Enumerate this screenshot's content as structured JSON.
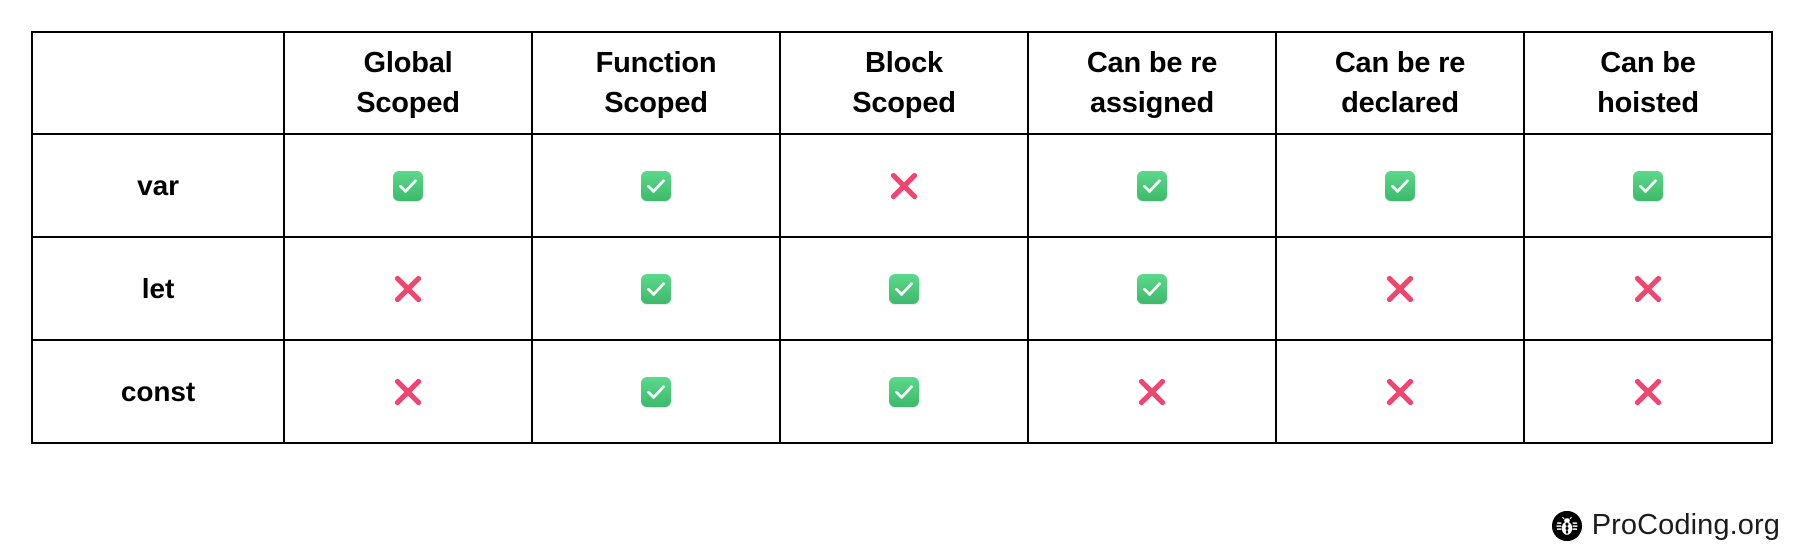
{
  "table": {
    "corner_label": "",
    "columns": [
      {
        "label": "Global\nScoped",
        "name": "global-scoped"
      },
      {
        "label": "Function\nScoped",
        "name": "function-scoped"
      },
      {
        "label": "Block\nScoped",
        "name": "block-scoped"
      },
      {
        "label": "Can be re\nassigned",
        "name": "can-be-reassigned"
      },
      {
        "label": "Can be re\ndeclared",
        "name": "can-be-redeclared"
      },
      {
        "label": "Can be\nhoisted",
        "name": "can-be-hoisted"
      }
    ],
    "rows": [
      {
        "label": "var",
        "values": [
          "yes",
          "yes",
          "no",
          "yes",
          "yes",
          "yes"
        ]
      },
      {
        "label": "let",
        "values": [
          "no",
          "yes",
          "yes",
          "yes",
          "no",
          "no"
        ]
      },
      {
        "label": "const",
        "values": [
          "no",
          "yes",
          "yes",
          "no",
          "no",
          "no"
        ]
      }
    ]
  },
  "marks": {
    "yes_icon": "check-mark-icon",
    "no_icon": "cross-mark-icon"
  },
  "watermark": {
    "icon": "bug-icon",
    "text": "ProCoding.org"
  },
  "colors": {
    "check_green": "#4AC878",
    "cross_pink": "#F0456E",
    "border": "#000000",
    "background": "#FFFFFF",
    "text": "#000000"
  }
}
